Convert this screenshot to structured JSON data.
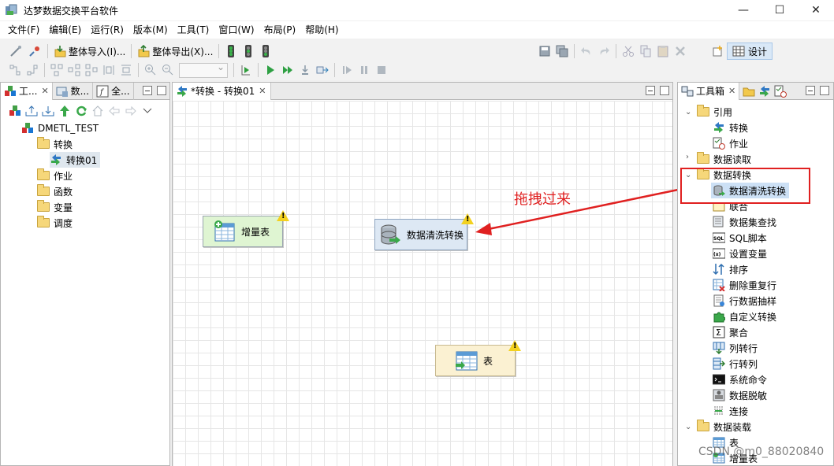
{
  "window": {
    "title": "达梦数据交换平台软件",
    "controls": [
      "—",
      "☐",
      "✕"
    ]
  },
  "menu": [
    "文件(F)",
    "编辑(E)",
    "运行(R)",
    "版本(M)",
    "工具(T)",
    "窗口(W)",
    "布局(P)",
    "帮助(H)"
  ],
  "toolbar": {
    "import_label": "整体导入(I)...",
    "export_label": "整体导出(X)...",
    "design_label": "设计"
  },
  "left_panel": {
    "tabs": [
      "工...",
      "数...",
      "全..."
    ],
    "tree": {
      "root": "DMETL_TEST",
      "items": [
        "转换",
        "转换01",
        "作业",
        "函数",
        "变量",
        "调度"
      ]
    }
  },
  "editor": {
    "tab_label": "*转换 - 转换01",
    "nodes": {
      "incremental": "增量表",
      "cleanse": "数据清洗转换",
      "table": "表"
    },
    "annotation": "拖拽过来"
  },
  "toolbox": {
    "tab_label": "工具箱",
    "categories": {
      "ref": "引用",
      "ref_items": [
        "转换",
        "作业"
      ],
      "read": "数据读取",
      "transform": "数据转换",
      "transform_items": [
        "数据清洗转换",
        "联合",
        "数据集查找",
        "SQL脚本",
        "设置变量",
        "排序",
        "删除重复行",
        "行数据抽样",
        "自定义转换",
        "聚合",
        "列转行",
        "行转列",
        "系统命令",
        "数据脱敏",
        "连接"
      ],
      "load": "数据装载",
      "load_items": [
        "表",
        "增量表"
      ]
    }
  },
  "watermark": "CSDN @m0_88020840",
  "colors": {
    "highlight_box": "#e02020",
    "arrow": "#e02020",
    "selection": "#cce0f5",
    "green_node": "#dff5d2",
    "blue_node": "#dde8f4",
    "yellow_node": "#fbf1d2"
  }
}
